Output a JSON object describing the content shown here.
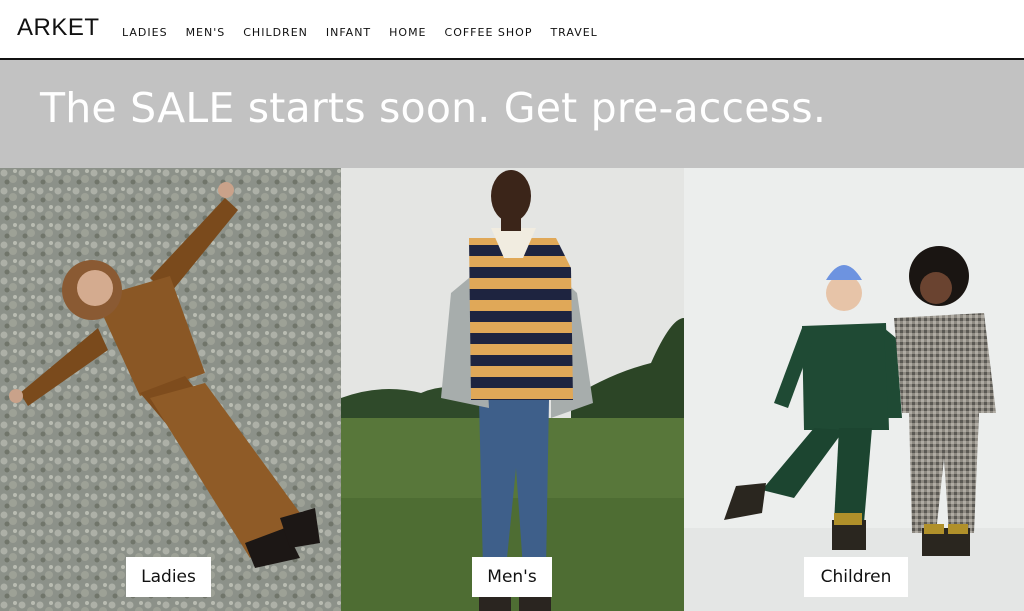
{
  "header": {
    "logo": "ARKET",
    "nav": [
      {
        "label": "LADIES"
      },
      {
        "label": "MEN'S"
      },
      {
        "label": "CHILDREN"
      },
      {
        "label": "INFANT"
      },
      {
        "label": "HOME"
      },
      {
        "label": "COFFEE SHOP"
      },
      {
        "label": "TRAVEL"
      }
    ]
  },
  "banner": {
    "headline": "The SALE starts soon. Get pre-access."
  },
  "categories": [
    {
      "label": "Ladies"
    },
    {
      "label": "Men's"
    },
    {
      "label": "Children"
    }
  ],
  "colors": {
    "banner_bg": "#c2c2c2",
    "header_rule": "#111111",
    "label_bg": "#ffffff"
  }
}
